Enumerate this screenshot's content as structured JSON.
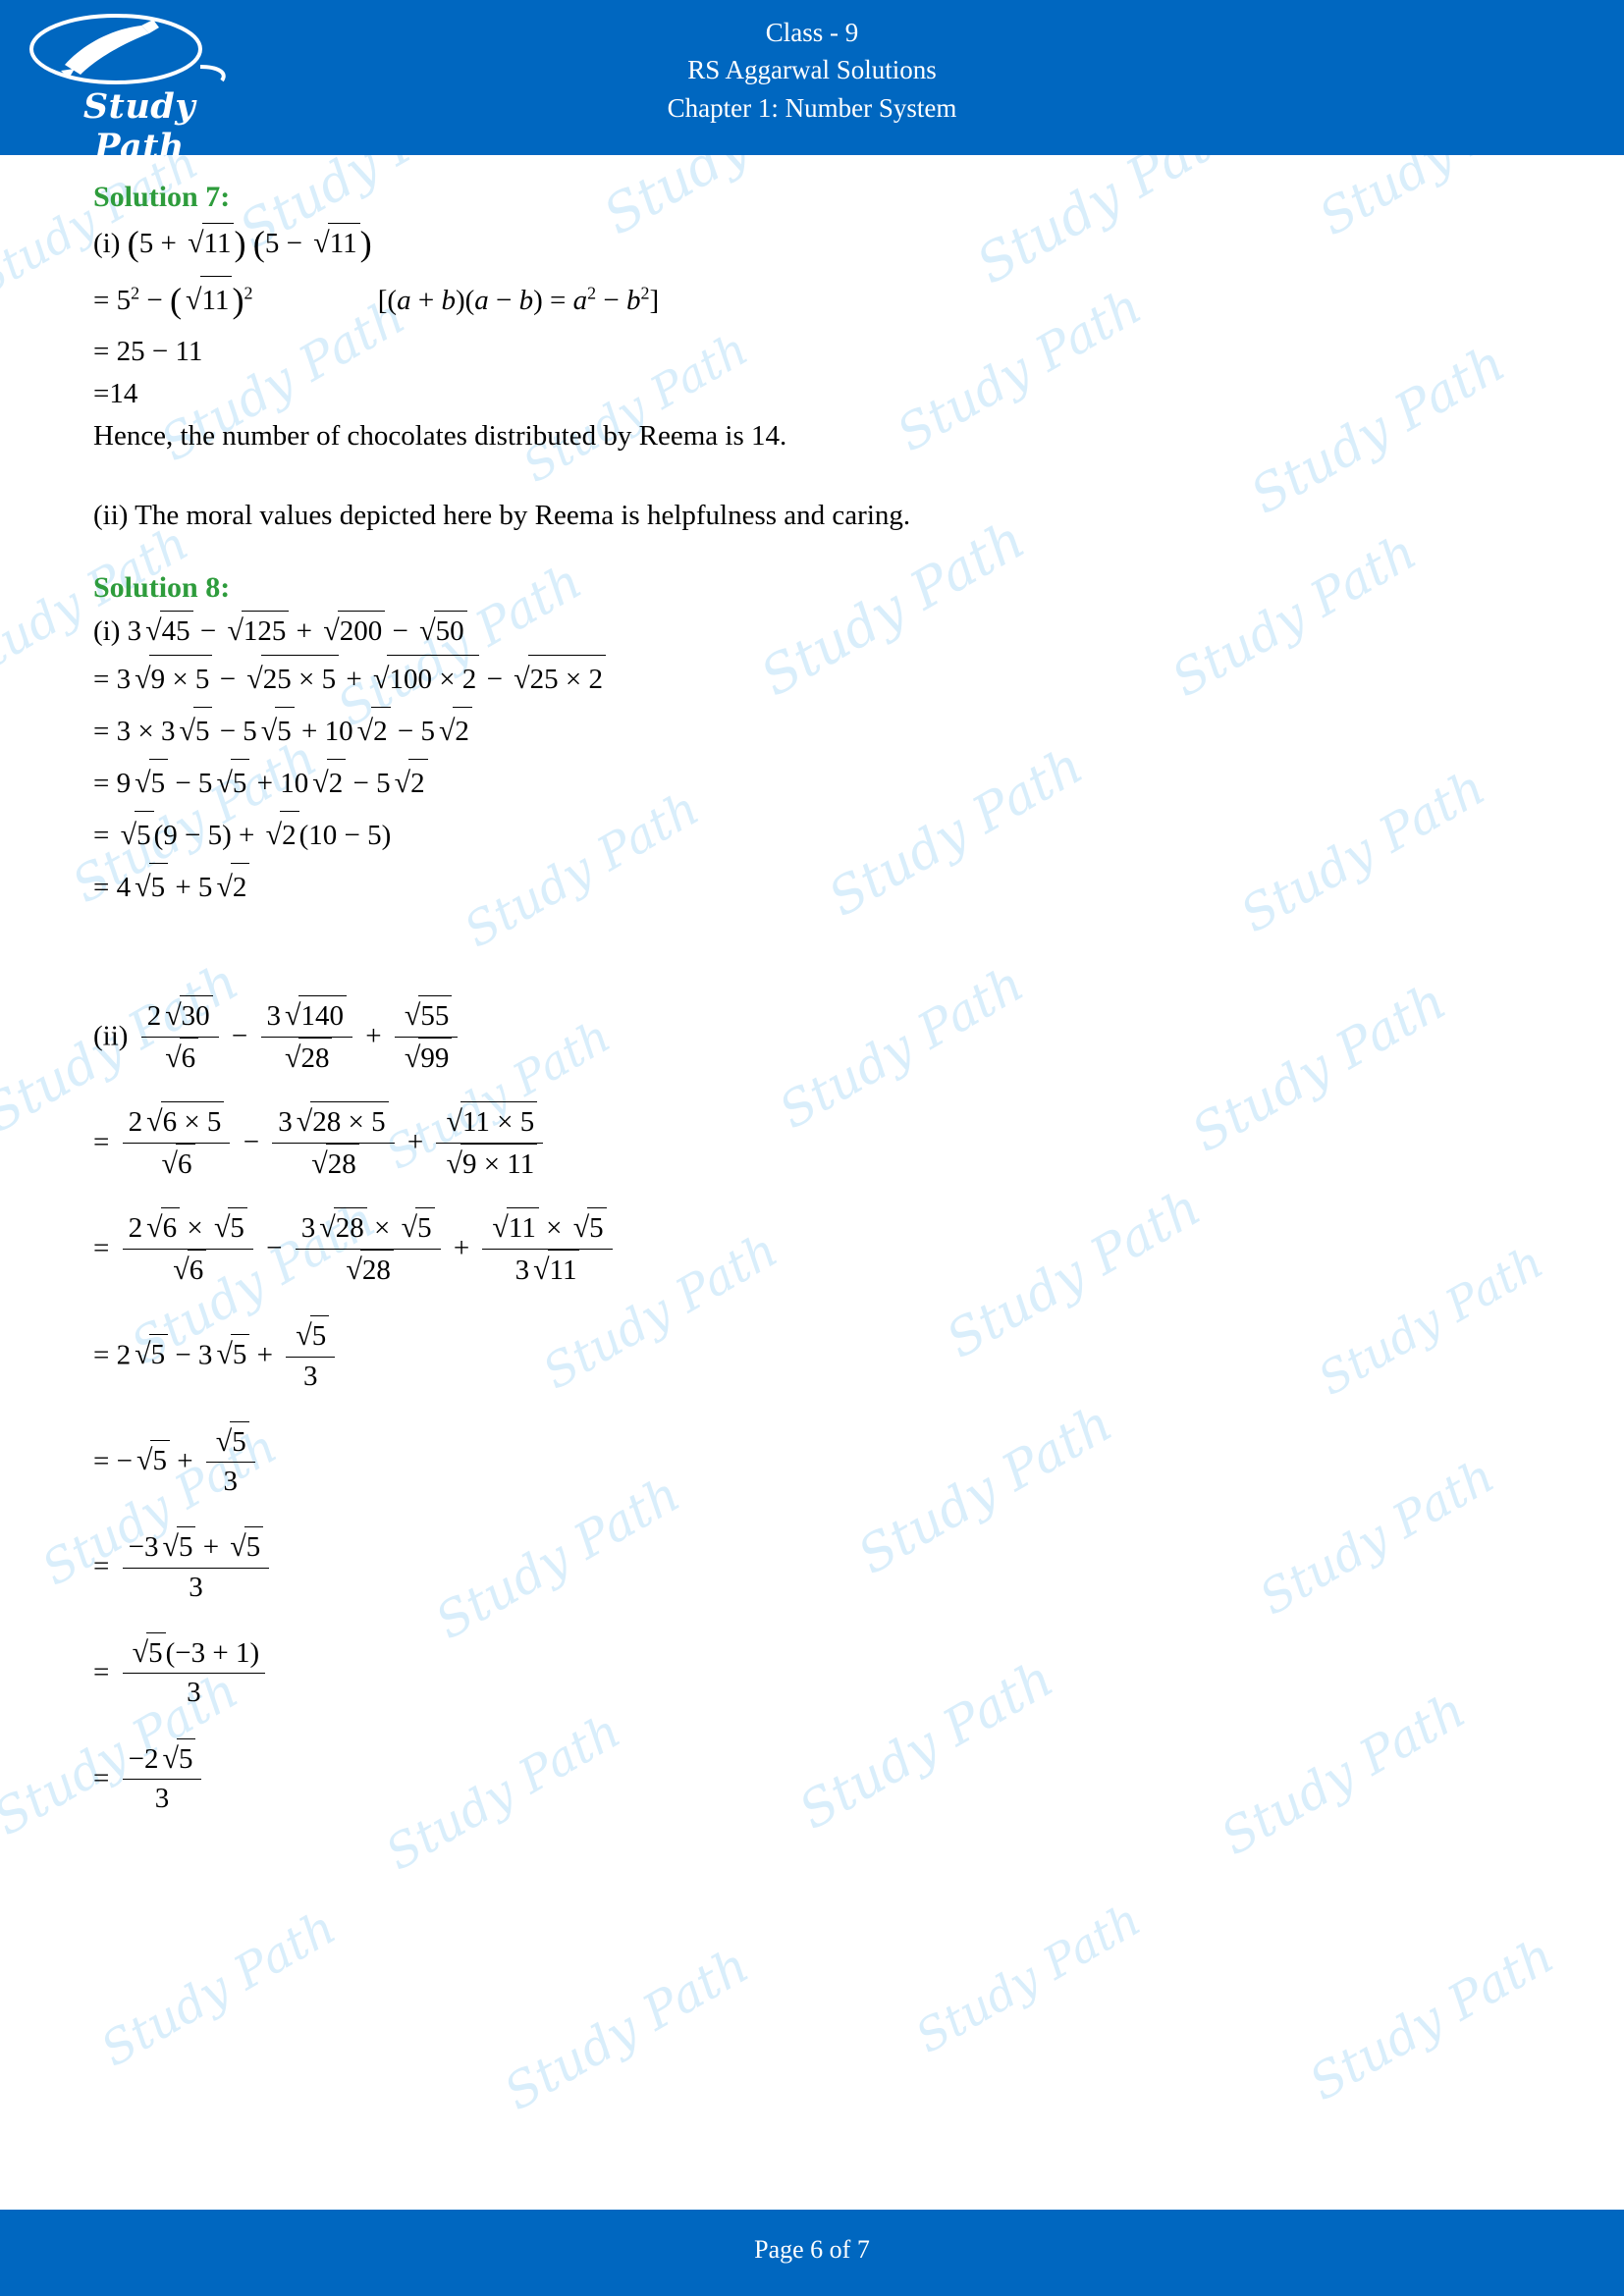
{
  "header": {
    "logo_text": "Study Path",
    "logo_icon": "pen-nib-icon",
    "line1": "Class - 9",
    "line2": "RS Aggarwal Solutions",
    "line3": "Chapter 1: Number System"
  },
  "footer": {
    "page_label": "Page 6 of 7"
  },
  "watermark": {
    "text": "Study Path",
    "color": "#d9eefb"
  },
  "content": {
    "solution7": {
      "heading": "Solution 7:",
      "lines": [
        "(i) (5 + √11) (5 − √11)",
        "= 5² − (√11)²        [(a + b)(a − b) = a² − b²]",
        "= 25 − 11",
        "=14",
        "Hence, the number of chocolates distributed by Reema is 14.",
        "(ii) The moral values depicted here by Reema is helpfulness and caring."
      ]
    },
    "solution8": {
      "heading": "Solution 8:",
      "part_i": [
        "(i) 3√45 − √125 + √200 − √50",
        "= 3√9 × 5 − √25 × 5 + √100 × 2 − √25 × 2",
        "= 3 × 3√5 − 5√5 + 10√2 − 5√2",
        "= 9√5 − 5√5 + 10√2 − 5√2",
        "= √5(9 − 5) + √2(10 − 5)",
        "= 4√5 + 5√2"
      ],
      "part_ii": [
        "(ii) 2√30/√6 − 3√140/√28 + √55/√99",
        "= 2√6 × 5/√6 − 3√28 × 5/√28 + √11 × 5/√9 × 11",
        "= 2√6 × √5/√6 − 3√28 × √5/√28 + √11 × √5/3√11",
        "= 2√5 − 3√5 + √5/3",
        "= −√5 + √5/3",
        "= (−3√5 + √5)/3",
        "= √5(−3 + 1)/3",
        "= −2√5/3"
      ]
    }
  },
  "colors": {
    "brand_blue": "#0067c0",
    "heading_green": "#2e9c3c",
    "watermark": "#d9eefb"
  }
}
